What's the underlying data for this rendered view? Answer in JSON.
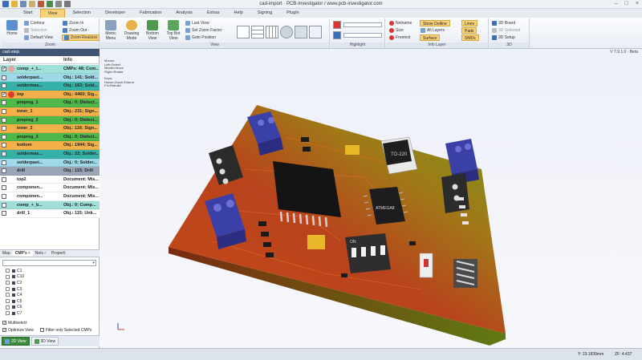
{
  "window": {
    "title": "cad-import · PCB-Investigator / www.pcb-investigator.com",
    "controls": [
      "–",
      "□",
      "×"
    ]
  },
  "tabs": [
    "Start",
    "View",
    "Selection",
    "Developer",
    "Fabrication",
    "Analysis",
    "Extras",
    "Help",
    "Signing",
    "PlugIn"
  ],
  "active_tab": "View",
  "ribbon": {
    "zoom_group": {
      "label": "Zoom",
      "home": "Home",
      "contour": "Contour",
      "selection": "Selection",
      "default_view": "Default View",
      "zoom_in": "Zoom In",
      "zoom_out": "Zoom Out",
      "zoom_realsize": "Zoom Realsize"
    },
    "view_group": {
      "label": "View",
      "metric": "Metric\nMenu",
      "drawing_mode": "Drawing\nMode",
      "bottom_view": "Bottom\nView",
      "top_bot_view": "Top Bot\nView",
      "last_view": "Last View",
      "set_zoom_factor": "Set Zoom Factor",
      "goto_position": "Goto Position"
    },
    "highlight_group": {
      "label": "Highlight"
    },
    "info_layer_group": {
      "label": "Info Layer",
      "netname": "Netname",
      "size": "Size",
      "freetext": "Freetext",
      "show_outline": "Show Outline",
      "all_layers": "All Layers",
      "surface": "Surface",
      "lines": "Lines",
      "pads": "Pads",
      "smds": "SMDs"
    },
    "three_d_group": {
      "label": "3D",
      "board": "3D Board",
      "selected": "3D Selected",
      "setup": "3D Setup"
    }
  },
  "left_panel": {
    "title": "cad-step",
    "col_layer": "Layer",
    "col_info": "Info",
    "layers": [
      {
        "name": "comp_+_t...",
        "info": "CMPs: 48; Com...",
        "bg": "#9fe1d8",
        "dot": "#e7a0a0",
        "checked": true
      },
      {
        "name": "solderpast...",
        "info": "Obj.: 141; Sold...",
        "bg": "#9fd8e8",
        "dot": "",
        "checked": false
      },
      {
        "name": "soldermas...",
        "info": "Obj.: 163; Sold...",
        "bg": "#36b1a8",
        "dot": "",
        "checked": false
      },
      {
        "name": "top",
        "info": "Obj.: 4460; Sig...",
        "bg": "#f4b14a",
        "dot": "#e23b2c",
        "checked": true
      },
      {
        "name": "prepreg_1",
        "info": "Obj.: 0; Dielect...",
        "bg": "#4fb84a",
        "dot": "",
        "checked": false
      },
      {
        "name": "inner_1",
        "info": "Obj.: 231; Sign...",
        "bg": "#f4b14a",
        "dot": "",
        "checked": false
      },
      {
        "name": "prepreg_2",
        "info": "Obj.: 0; Dielect...",
        "bg": "#4fb84a",
        "dot": "",
        "checked": false
      },
      {
        "name": "inner_2",
        "info": "Obj.: 116; Sign...",
        "bg": "#f4b14a",
        "dot": "",
        "checked": false
      },
      {
        "name": "prepreg_3",
        "info": "Obj.: 0; Dielect...",
        "bg": "#4fb84a",
        "dot": "",
        "checked": false
      },
      {
        "name": "bottom",
        "info": "Obj.: 1944; Sig...",
        "bg": "#f4b14a",
        "dot": "",
        "checked": false
      },
      {
        "name": "soldermas...",
        "info": "Obj.: 22; Solder...",
        "bg": "#36b1a8",
        "dot": "",
        "checked": false
      },
      {
        "name": "solderpast...",
        "info": "Obj.: 0; Solder...",
        "bg": "#9fd8e8",
        "dot": "",
        "checked": false
      },
      {
        "name": "drill",
        "info": "Obj.: 115; Drill",
        "bg": "#9aa6b6",
        "dot": "",
        "checked": false
      },
      {
        "name": "top2",
        "info": "Document; Mis...",
        "bg": "#ffffff",
        "dot": "",
        "checked": false
      },
      {
        "name": "componen...",
        "info": "Document; Mis...",
        "bg": "#ffffff",
        "dot": "",
        "checked": false
      },
      {
        "name": "componen...",
        "info": "Document; Mis...",
        "bg": "#ffffff",
        "dot": "",
        "checked": false
      },
      {
        "name": "comp_+_b...",
        "info": "Obj.: 0; Comp...",
        "bg": "#9fe1d8",
        "dot": "",
        "checked": false
      },
      {
        "name": "drill_1",
        "info": "Obj.: 115; Unk...",
        "bg": "#ffffff",
        "dot": "",
        "checked": false
      }
    ],
    "subtabs": [
      "Map",
      "CMP's",
      "Nets",
      "Properti"
    ],
    "components": [
      "C1",
      "C10",
      "C2",
      "C3",
      "C4",
      "C5",
      "C6",
      "C7",
      "C8"
    ],
    "options": {
      "multiselect": "Multiselect",
      "optimize_view": "Optimize View",
      "filter_selected": "Filter only Selected CMPs"
    },
    "view_tabs": [
      "2D View",
      "3D View"
    ]
  },
  "viewport": {
    "version": "V 7.9.1.0 - Beta",
    "info_lines": [
      "Mouse:",
      "Left=Select",
      "Middle=Move",
      "Right=Rotate",
      "",
      "Keys:",
      "Home=Zoom Extend",
      "F3=Rebuild"
    ],
    "chip_labels": {
      "mcu": "ATMEGA8",
      "cap": "TO-220",
      "dip": "ON"
    }
  },
  "status": {
    "coord": "Y: 23.1839mm",
    "zoom": "ZF: 4.437"
  }
}
